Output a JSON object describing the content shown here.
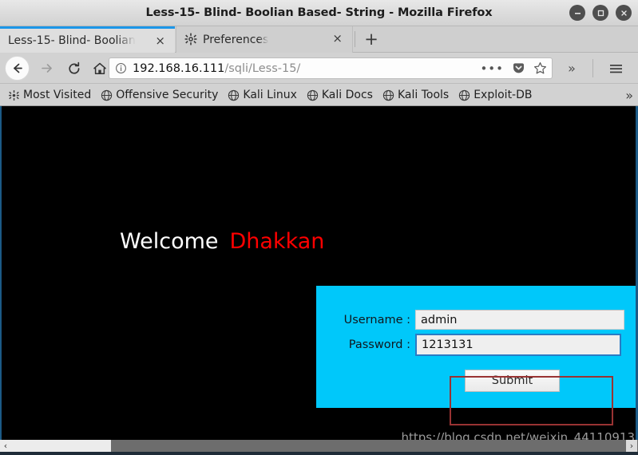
{
  "window": {
    "title": "Less-15- Blind- Boolian Based- String - Mozilla Firefox",
    "minimize_label": "−",
    "maximize_label": "□",
    "close_label": "×"
  },
  "tabs": [
    {
      "label": "Less-15- Blind- Boolian",
      "close_label": "×",
      "active": true
    },
    {
      "label": "Preferences",
      "close_label": "×",
      "active": false
    }
  ],
  "newtab_label": "+",
  "nav": {
    "back_label": "back-arrow",
    "forward_label": "forward-arrow",
    "reload_label": "reload",
    "home_label": "home"
  },
  "urlbar": {
    "host": "192.168.16.111",
    "path": "/sqli/Less-15/",
    "page_actions_label": "•••",
    "overflow_label": "»",
    "menu_label": "menu"
  },
  "bookmarks": {
    "items": [
      {
        "label": "Most Visited",
        "icon": "star-gear-icon"
      },
      {
        "label": "Offensive Security",
        "icon": "globe-icon"
      },
      {
        "label": "Kali Linux",
        "icon": "globe-icon"
      },
      {
        "label": "Kali Docs",
        "icon": "globe-icon"
      },
      {
        "label": "Kali Tools",
        "icon": "globe-icon"
      },
      {
        "label": "Exploit-DB",
        "icon": "globe-icon"
      }
    ],
    "overflow_label": "»"
  },
  "page": {
    "welcome_text": "Welcome",
    "welcome_name": "Dhakkan",
    "form": {
      "username_label": "Username :",
      "username_value": "admin",
      "password_label": "Password :",
      "password_value": "1213131",
      "submit_label": "Submit"
    },
    "watermark": "https://blog.csdn.net/weixin_44110913"
  },
  "scrollbar": {
    "left_arrow": "‹",
    "right_arrow": "›"
  },
  "colors": {
    "panel_cyan": "#00c8fa",
    "name_red": "#ff0000",
    "highlight_box": "#993333",
    "tab_active_accent": "#1c96e8"
  }
}
